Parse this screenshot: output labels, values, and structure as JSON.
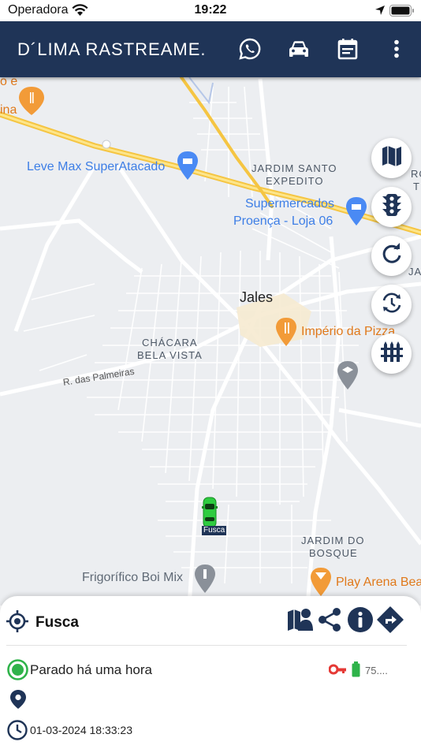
{
  "status_bar": {
    "carrier": "Operadora",
    "time": "19:22"
  },
  "app_bar": {
    "title": "D´LIMA RASTREAME...",
    "icons": [
      "whatsapp-icon",
      "car-icon",
      "calendar-icon",
      "more-vert-icon"
    ]
  },
  "map": {
    "labels": {
      "leve_max": "Leve Max SuperAtacado",
      "supermercados_1": "Supermercados",
      "supermercados_2": "Proença - Loja 06",
      "jardim_santo_1": "JARDIM SANTO",
      "jardim_santo_2": "EXPEDITO",
      "jales": "Jales",
      "imperio": "Império da Pizza",
      "chacara_1": "CHÁCARA",
      "chacara_2": "BELA VISTA",
      "r_palmeiras": "R. das Palmeiras",
      "jardim_bosque_1": "JARDIM DO",
      "jardim_bosque_2": "BOSQUE",
      "frigorifico": "Frigorífico Boi Mix",
      "play_arena": "Play Arena Bea",
      "top_left_1": "o e",
      "top_left_2": "ina",
      "right_edge_1": "RO",
      "right_edge_2": "T",
      "right_edge_3": "JAR"
    },
    "side_buttons": [
      "map-layers-icon",
      "traffic-light-icon",
      "refresh-icon",
      "sync-icon",
      "geofence-icon"
    ],
    "vehicle_tag": "Fusca",
    "vehicle_color": "#2ecc40"
  },
  "panel": {
    "vehicle_name": "Fusca",
    "status": "Parado há uma hora",
    "battery": "75....",
    "datetime": "01-03-2024 18:33:23",
    "status_color": "#2fb34a",
    "ignition_color": "#e53935"
  }
}
